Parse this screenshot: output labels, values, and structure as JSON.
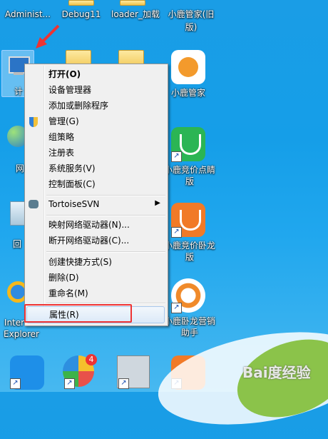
{
  "desktop": {
    "top_labels": [
      "Administ...",
      "Debug11",
      "loader_加载",
      "小鹿管家(旧",
      "版)"
    ],
    "right_labels": {
      "deer_manager": "小鹿管家",
      "bid_line1": "小鹿竞价点睛",
      "bid_line2": "版",
      "dragon_line1": "小鹿竞价卧龙",
      "dragon_line2": "版",
      "assist_line1": "小鹿卧龙营销",
      "assist_line2": "助手"
    },
    "left_labels": {
      "computer": "计",
      "network": "网",
      "recycle": "回",
      "ie_line1": "Inter",
      "ie_line2": "Explorer"
    },
    "badge_count": "4"
  },
  "context_menu": {
    "open": "打开(O)",
    "device_manager": "设备管理器",
    "add_remove": "添加或删除程序",
    "manage": "管理(G)",
    "group_policy": "组策略",
    "registry": "注册表",
    "system_services": "系统服务(V)",
    "control_panel": "控制面板(C)",
    "tortoise": "TortoiseSVN",
    "map_drive": "映射网络驱动器(N)...",
    "disconnect_drive": "断开网络驱动器(C)...",
    "create_shortcut": "创建快捷方式(S)",
    "delete": "删除(D)",
    "rename": "重命名(M)",
    "properties": "属性(R)"
  },
  "watermark": "Bai度经验",
  "colors": {
    "highlight_box": "#e33333",
    "arrow": "#e33333",
    "desktop_bg": "#1a9de6"
  }
}
